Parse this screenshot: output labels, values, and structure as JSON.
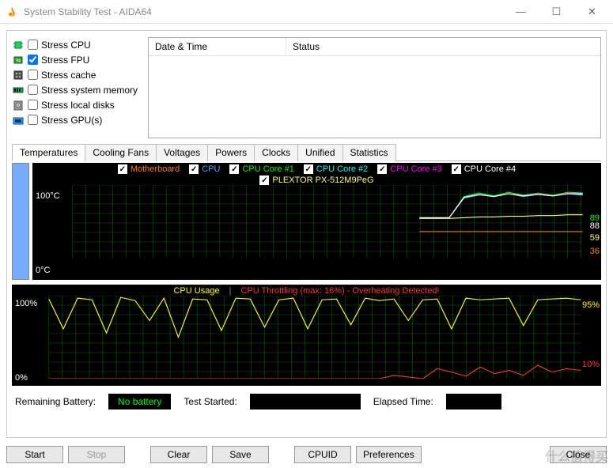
{
  "window": {
    "title": "System Stability Test - AIDA64",
    "min": "—",
    "max": "☐",
    "close": "✕"
  },
  "stress": {
    "items": [
      {
        "label": "Stress CPU",
        "checked": false
      },
      {
        "label": "Stress FPU",
        "checked": true
      },
      {
        "label": "Stress cache",
        "checked": false
      },
      {
        "label": "Stress system memory",
        "checked": false
      },
      {
        "label": "Stress local disks",
        "checked": false
      },
      {
        "label": "Stress GPU(s)",
        "checked": false
      }
    ]
  },
  "log_headers": {
    "datetime": "Date & Time",
    "status": "Status"
  },
  "tabs": [
    "Temperatures",
    "Cooling Fans",
    "Voltages",
    "Powers",
    "Clocks",
    "Unified",
    "Statistics"
  ],
  "active_tab": 0,
  "temp_legend": [
    {
      "label": "Motherboard",
      "color": "#ff8000"
    },
    {
      "label": "CPU",
      "color": "#4da6ff"
    },
    {
      "label": "CPU Core #1",
      "color": "#00ff00"
    },
    {
      "label": "CPU Core #2",
      "color": "#00ffff"
    },
    {
      "label": "CPU Core #3",
      "color": "#ff00ff"
    },
    {
      "label": "CPU Core #4",
      "color": "#ffffff"
    }
  ],
  "temp_legend2": [
    {
      "label": "PLEXTOR PX-512M9PeG",
      "color": "#ffff66"
    }
  ],
  "temp_axis": {
    "top": "100°C",
    "bottom": "0°C"
  },
  "temp_readouts": [
    {
      "text": "89",
      "color": "#00ff00",
      "y": 30
    },
    {
      "text": "88",
      "color": "#ffffff",
      "y": 40
    },
    {
      "text": "59",
      "color": "#ffff66",
      "y": 55
    },
    {
      "text": "36",
      "color": "#ff8000",
      "y": 72
    }
  ],
  "usage_legend": {
    "usageLabel": "CPU Usage",
    "throttleLabel": "CPU Throttling (max: 16%) - Overheating Detected!",
    "usageColor": "#ffff00",
    "throttleColor": "#ff3333"
  },
  "usage_axis": {
    "top": "100%",
    "bottom": "0%"
  },
  "usage_readouts": [
    {
      "text": "95%",
      "color": "#ffff00",
      "y": 20
    },
    {
      "text": "10%",
      "color": "#ff3333",
      "y": 95
    }
  ],
  "status": {
    "remaining_label": "Remaining Battery:",
    "remaining_value": "No battery",
    "started_label": "Test Started:",
    "started_value": "",
    "elapsed_label": "Elapsed Time:",
    "elapsed_value": ""
  },
  "buttons": {
    "start": "Start",
    "stop": "Stop",
    "clear": "Clear",
    "save": "Save",
    "cpuid": "CPUID",
    "prefs": "Preferences",
    "close": "Close"
  },
  "watermark": "什么值得买",
  "chart_data": [
    {
      "type": "line",
      "title": "Temperatures",
      "ylabel": "°C",
      "ylim": [
        0,
        100
      ],
      "x_start_fraction": 0.68,
      "series": [
        {
          "name": "Motherboard",
          "color": "#ff8000",
          "approx_values": [
            36,
            36,
            36,
            36,
            36,
            36,
            36,
            36,
            36,
            36,
            36,
            36
          ]
        },
        {
          "name": "CPU",
          "color": "#4da6ff",
          "approx_values": [
            55,
            55,
            55,
            82,
            86,
            85,
            88,
            84,
            87,
            85,
            88,
            86
          ]
        },
        {
          "name": "CPU Core #1",
          "color": "#00ff00",
          "approx_values": [
            55,
            55,
            55,
            84,
            89,
            85,
            90,
            86,
            89,
            86,
            90,
            89
          ]
        },
        {
          "name": "CPU Core #2",
          "color": "#00ffff",
          "approx_values": [
            55,
            55,
            55,
            83,
            87,
            84,
            88,
            85,
            87,
            85,
            88,
            87
          ]
        },
        {
          "name": "CPU Core #3",
          "color": "#ff00ff",
          "approx_values": [
            55,
            55,
            55,
            83,
            87,
            84,
            88,
            85,
            88,
            85,
            89,
            88
          ]
        },
        {
          "name": "CPU Core #4",
          "color": "#ffffff",
          "approx_values": [
            55,
            55,
            55,
            83,
            87,
            84,
            88,
            85,
            87,
            85,
            88,
            88
          ]
        },
        {
          "name": "PLEXTOR PX-512M9PeG",
          "color": "#ffff66",
          "approx_values": [
            54,
            54,
            54,
            55,
            56,
            56,
            57,
            57,
            58,
            58,
            59,
            59
          ]
        }
      ]
    },
    {
      "type": "line",
      "title": "CPU Usage / Throttling",
      "ylabel": "%",
      "ylim": [
        0,
        100
      ],
      "series": [
        {
          "name": "CPU Usage",
          "color": "#ffff00",
          "approx_values": [
            96,
            60,
            97,
            95,
            55,
            98,
            94,
            70,
            97,
            50,
            96,
            95,
            58,
            97,
            96,
            62,
            95,
            97,
            60,
            95,
            96,
            65,
            97,
            94,
            96,
            70,
            95,
            96,
            60,
            97,
            95,
            96,
            97,
            64,
            95,
            96,
            97,
            95
          ]
        },
        {
          "name": "CPU Throttling",
          "color": "#ff3333",
          "approx_values": [
            0,
            0,
            0,
            0,
            0,
            0,
            0,
            0,
            0,
            0,
            0,
            0,
            0,
            0,
            0,
            0,
            0,
            0,
            0,
            0,
            0,
            0,
            0,
            0,
            4,
            2,
            0,
            12,
            8,
            3,
            14,
            6,
            10,
            4,
            16,
            8,
            12,
            10
          ]
        }
      ]
    }
  ]
}
